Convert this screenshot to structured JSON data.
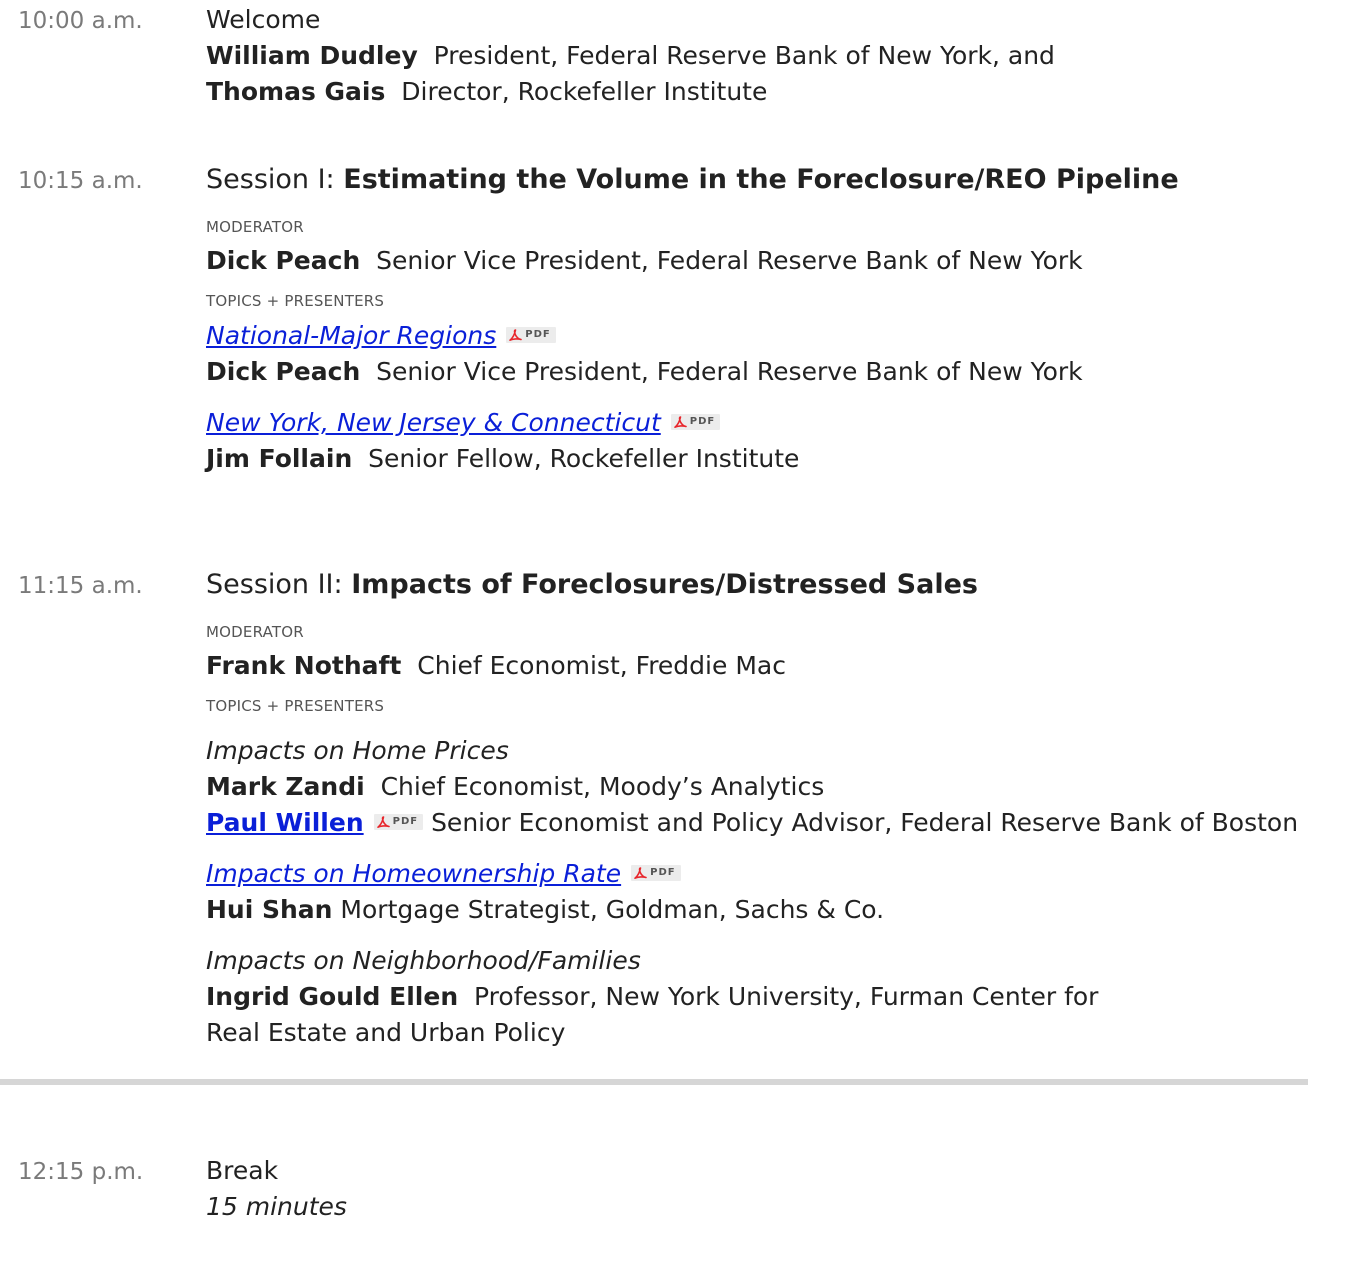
{
  "pdf_label": "PDF",
  "icons": {
    "pdf": "adobe-pdf-icon"
  },
  "colors": {
    "link": "#0a1fd8",
    "time": "#7a7a7a",
    "divider": "#d6d6d6"
  },
  "welcome": {
    "time": "10:00 a.m.",
    "title": "Welcome",
    "speakers": [
      {
        "name": "William Dudley",
        "role": "President, Federal Reserve Bank of New York, and"
      },
      {
        "name": "Thomas Gais",
        "role": "Director, Rockefeller Institute"
      }
    ]
  },
  "session1": {
    "time": "10:15 a.m.",
    "prefix": "Session I:",
    "title": "Estimating the Volume in the Foreclosure/REO Pipeline",
    "moderator_label": "MODERATOR",
    "moderator": {
      "name": "Dick Peach",
      "role": "Senior Vice President, Federal Reserve Bank of New York"
    },
    "topics_label": "TOPICS + PRESENTERS",
    "topics": [
      {
        "title": "National-Major Regions",
        "name": "Dick Peach",
        "role": "Senior Vice President, Federal Reserve Bank of New York"
      },
      {
        "title": "New York, New Jersey & Connecticut",
        "name": "Jim Follain",
        "role": "Senior Fellow, Rockefeller Institute"
      }
    ]
  },
  "session2": {
    "time": "11:15 a.m.",
    "prefix": "Session II:",
    "title": "Impacts of Foreclosures/Distressed Sales",
    "moderator_label": "MODERATOR",
    "moderator": {
      "name": "Frank Nothaft",
      "role": "Chief Economist, Freddie Mac"
    },
    "topics_label": "TOPICS + PRESENTERS",
    "topic1": {
      "title": "Impacts on Home Prices",
      "speaker1": {
        "name": "Mark Zandi",
        "role": "Chief Economist, Moody’s Analytics"
      },
      "speaker2": {
        "name": "Paul Willen",
        "role": "Senior Economist and Policy Advisor, Federal Reserve Bank of Boston"
      }
    },
    "topic2": {
      "title": "Impacts on Homeownership Rate",
      "speaker": {
        "name": "Hui Shan",
        "role": "Mortgage Strategist, Goldman, Sachs & Co."
      }
    },
    "topic3": {
      "title": "Impacts on Neighborhood/Families",
      "speaker": {
        "name": "Ingrid Gould Ellen",
        "role": "Professor, New York University, Furman Center for",
        "role_cont": "Real Estate and Urban Policy"
      }
    }
  },
  "break": {
    "time": "12:15 p.m.",
    "title": "Break",
    "duration": "15 minutes"
  }
}
